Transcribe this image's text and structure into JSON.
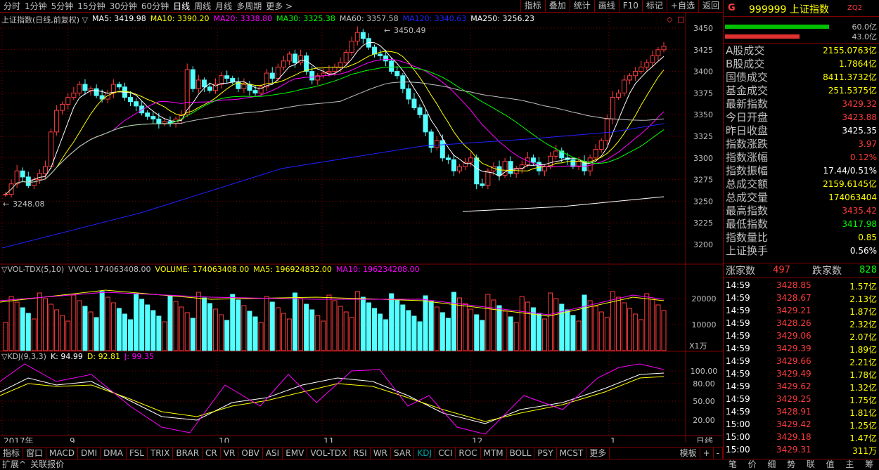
{
  "top_tabs": [
    "分时",
    "1分钟",
    "5分钟",
    "15分钟",
    "30分钟",
    "60分钟",
    "日线",
    "周线",
    "月线",
    "多周期",
    "更多 >"
  ],
  "top_tabs_active": 6,
  "right_tools": [
    "指标",
    "叠加",
    "统计",
    "画线",
    "F10",
    "标记",
    "+自选",
    "返回"
  ],
  "main_legend": {
    "title": "上证指数(日线,前复权) ▽",
    "ma5": "MA5: 3419.98",
    "ma10": "MA10: 3390.20",
    "ma20": "MA20: 3338.80",
    "ma30": "MA30: 3325.38",
    "ma60": "MA60: 3357.58",
    "ma120": "MA120: 3340.63",
    "ma250": "MA250: 3256.23"
  },
  "price_axis": [
    "3450",
    "3425",
    "3400",
    "3375",
    "3350",
    "3325",
    "3300",
    "3275",
    "3250",
    "3225",
    "3200"
  ],
  "annotations": {
    "high": "3450.49",
    "low": "3248.08"
  },
  "vol_legend": {
    "name": "▽VOL-TDX(5,10)",
    "vvol": "VVOL: 174063408.00",
    "volume": "VOLUME: 174063408.00",
    "ma5": "MA5: 196924832.00",
    "ma10": "MA10: 196234208.00"
  },
  "vol_axis": [
    "20000",
    "10000"
  ],
  "vol_unit": "X1万",
  "kdj_legend": {
    "name": "▽KDJ(9,3,3)",
    "k": "K: 94.99",
    "d": "D: 92.81",
    "j": "J: 99.35"
  },
  "kdj_axis": [
    "100.00",
    "80.00",
    "50.00",
    "20.00"
  ],
  "date_axis": [
    "2017年",
    "9",
    "10",
    "11",
    "12",
    "1"
  ],
  "date_period": "日线",
  "bottom_tabs": [
    "指标",
    "窗口",
    "MACD",
    "DMI",
    "DMA",
    "FSL",
    "TRIX",
    "BRAR",
    "CR",
    "VR",
    "OBV",
    "ASI",
    "EMV",
    "VOL-TDX",
    "RSI",
    "WR",
    "SAR",
    "KDJ",
    "CCI",
    "ROC",
    "MTM",
    "BOLL",
    "PSY",
    "MCST",
    "更多"
  ],
  "bottom_tabs_active": 17,
  "bottom_right": [
    "模板",
    "+",
    "-"
  ],
  "status": [
    "扩展^",
    "关联报价"
  ],
  "side": {
    "g": "G",
    "code": "999999 上证指数",
    "zq": "ZQ2",
    "ratio_up": "60.0亿",
    "ratio_down": "43.0亿",
    "stats": [
      {
        "label": "A股成交",
        "value": "2155.0763亿",
        "color": "#ffff00"
      },
      {
        "label": "B股成交",
        "value": "1.7864亿",
        "color": "#ffff00"
      },
      {
        "label": "国债成交",
        "value": "8411.3732亿",
        "color": "#ffff00"
      },
      {
        "label": "基金成交",
        "value": "251.5375亿",
        "color": "#ffff00"
      },
      {
        "label": "最新指数",
        "value": "3429.32",
        "color": "#ff3c3c"
      },
      {
        "label": "今日开盘",
        "value": "3423.88",
        "color": "#ff3c3c"
      },
      {
        "label": "昨日收盘",
        "value": "3425.35",
        "color": "#ffffff"
      },
      {
        "label": "指数涨跌",
        "value": "3.97",
        "color": "#ff3c3c"
      },
      {
        "label": "指数涨幅",
        "value": "0.12%",
        "color": "#ff3c3c"
      },
      {
        "label": "指数振幅",
        "value": "17.44/0.51%",
        "color": "#ffffff"
      },
      {
        "label": "总成交额",
        "value": "2159.6145亿",
        "color": "#ffff00"
      },
      {
        "label": "总成交量",
        "value": "174063404",
        "color": "#ffff00"
      },
      {
        "label": "最高指数",
        "value": "3435.42",
        "color": "#ff3c3c"
      },
      {
        "label": "最低指数",
        "value": "3417.98",
        "color": "#00ff00"
      },
      {
        "label": "指数量比",
        "value": "0.85",
        "color": "#ffff00"
      },
      {
        "label": "上证换手",
        "value": "0.56%",
        "color": "#ffffff"
      }
    ],
    "breadth": {
      "up_label": "涨家数",
      "up_value": "497",
      "down_label": "跌家数",
      "down_value": "828"
    },
    "ticks": [
      {
        "time": "14:59",
        "price": "3428.85",
        "vol": "1.57亿"
      },
      {
        "time": "14:59",
        "price": "3428.67",
        "vol": "2.13亿"
      },
      {
        "time": "14:59",
        "price": "3429.21",
        "vol": "1.87亿"
      },
      {
        "time": "14:59",
        "price": "3428.26",
        "vol": "2.32亿"
      },
      {
        "time": "14:59",
        "price": "3429.06",
        "vol": "2.07亿"
      },
      {
        "time": "14:59",
        "price": "3429.39",
        "vol": "1.89亿"
      },
      {
        "time": "14:59",
        "price": "3429.66",
        "vol": "2.21亿"
      },
      {
        "time": "14:59",
        "price": "3429.49",
        "vol": "1.78亿"
      },
      {
        "time": "14:59",
        "price": "3429.62",
        "vol": "1.32亿"
      },
      {
        "time": "14:59",
        "price": "3429.25",
        "vol": "1.75亿"
      },
      {
        "time": "14:59",
        "price": "3428.91",
        "vol": "1.81亿"
      },
      {
        "time": "15:00",
        "price": "3429.42",
        "vol": "1.25亿"
      },
      {
        "time": "15:00",
        "price": "3429.18",
        "vol": "1.47亿"
      },
      {
        "time": "15:00",
        "price": "3429.31",
        "vol": "311万"
      }
    ],
    "footer": [
      "笔",
      "价",
      "细",
      "势",
      "联",
      "值",
      "主",
      "筹"
    ]
  }
}
